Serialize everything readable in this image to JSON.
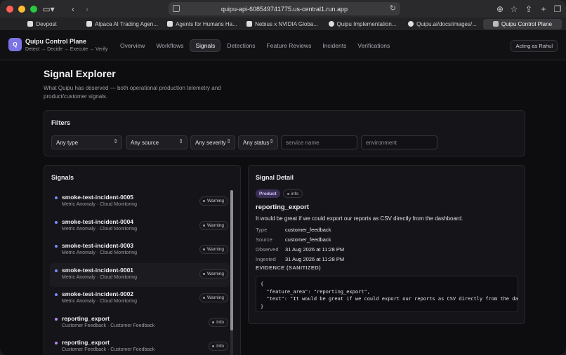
{
  "browser": {
    "url": "quipu-api-608549741775.us-central1.run.app",
    "tabs": [
      {
        "label": "Devpost",
        "active": false
      },
      {
        "label": "Alpaca AI Trading Agen...",
        "active": false
      },
      {
        "label": "Agents for Humans Ha...",
        "active": false
      },
      {
        "label": "Nebius x NVIDIA Globa...",
        "active": false
      },
      {
        "label": "Quipu Implementation...",
        "active": false
      },
      {
        "label": "Quipu.ai/docs/images/...",
        "active": false
      },
      {
        "label": "Quipu Control Plane",
        "active": true
      }
    ]
  },
  "header": {
    "logo_letter": "Q",
    "brand_title": "Quipu Control Plane",
    "brand_subtitle": "Detect → Decide → Execute → Verify",
    "nav": [
      "Overview",
      "Workflows",
      "Signals",
      "Detections",
      "Feature Reviews",
      "Incidents",
      "Verifications"
    ],
    "active_nav": "Signals",
    "acting_as": "Acting as Rahul"
  },
  "page": {
    "title": "Signal Explorer",
    "description": "What Quipu has observed — both operational production telemetry and product/customer signals."
  },
  "filters": {
    "title": "Filters",
    "type": "Any type",
    "source": "Any source",
    "severity": "Any severity",
    "status": "Any status",
    "service_placeholder": "service name",
    "environment_placeholder": "environment"
  },
  "signals": {
    "title": "Signals",
    "items": [
      {
        "name": "smoke-test-incident-0005",
        "meta": "Metric Anomaly · Cloud Monitoring",
        "severity": "Warning",
        "dot_color": "#7c8cff"
      },
      {
        "name": "smoke-test-incident-0004",
        "meta": "Metric Anomaly · Cloud Monitoring",
        "severity": "Warning",
        "dot_color": "#7c8cff"
      },
      {
        "name": "smoke-test-incident-0003",
        "meta": "Metric Anomaly · Cloud Monitoring",
        "severity": "Warning",
        "dot_color": "#7c8cff"
      },
      {
        "name": "smoke-test-incident-0001",
        "meta": "Metric Anomaly · Cloud Monitoring",
        "severity": "Warning",
        "dot_color": "#7c8cff"
      },
      {
        "name": "smoke-test-incident-0002",
        "meta": "Metric Anomaly · Cloud Monitoring",
        "severity": "Warning",
        "dot_color": "#7c8cff"
      },
      {
        "name": "reporting_export",
        "meta": "Customer Feedback · Customer Feedback",
        "severity": "Info",
        "dot_color": "#b48cf0"
      },
      {
        "name": "reporting_export",
        "meta": "Customer Feedback · Customer Feedback",
        "severity": "Info",
        "dot_color": "#b48cf0"
      }
    ]
  },
  "detail": {
    "title": "Signal Detail",
    "badge_category": "Product",
    "badge_severity": "info",
    "name": "reporting_export",
    "text": "It would be great if we could export our reports as CSV directly from the dashboard.",
    "fields": {
      "type_label": "Type",
      "type_value": "customer_feedback",
      "source_label": "Source",
      "source_value": "customer_feedback",
      "observed_label": "Observed",
      "observed_value": "31 Aug 2026 at 11:28 PM",
      "ingested_label": "Ingested",
      "ingested_value": "31 Aug 2026 at 11:28 PM"
    },
    "evidence_label": "EVIDENCE (SANITIZED)",
    "evidence": "{\n  \"feature_area\": \"reporting_export\",\n  \"text\": \"It would be great if we could export our reports as CSV directly from the dashboard.\"\n}"
  },
  "colors": {
    "accent": "#7c74e6",
    "product_badge": "#3a2f55"
  }
}
